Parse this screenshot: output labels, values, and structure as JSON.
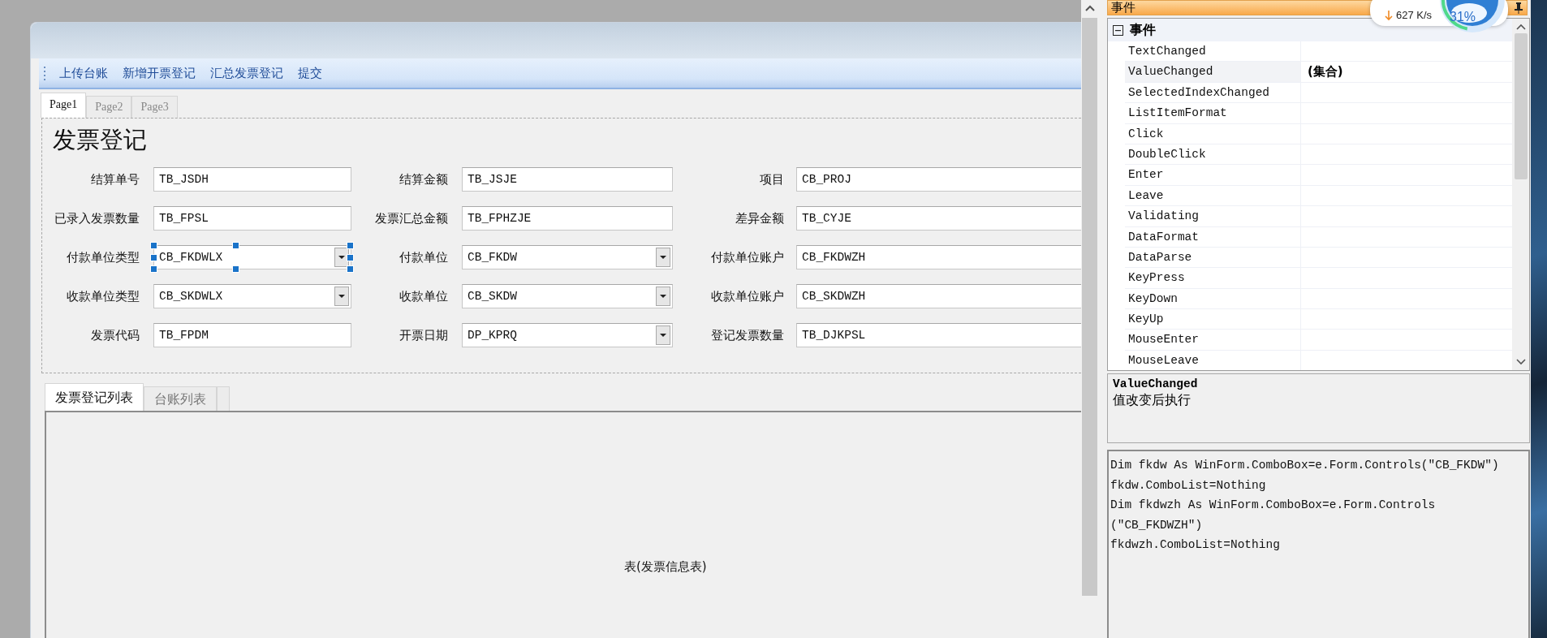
{
  "designer": {
    "toolbar": [
      {
        "label": "上传台账"
      },
      {
        "label": "新增开票登记"
      },
      {
        "label": "汇总发票登记"
      },
      {
        "label": "提交"
      }
    ],
    "page_tabs": [
      {
        "label": "Page1",
        "selected": true
      },
      {
        "label": "Page2",
        "selected": false
      },
      {
        "label": "Page3",
        "selected": false
      }
    ],
    "form": {
      "title": "发票登记",
      "rows": [
        [
          {
            "label": "结算单号",
            "value": "TB_JSDH",
            "kind": "text",
            "selected": false
          },
          {
            "label": "结算金额",
            "value": "TB_JSJE",
            "kind": "text",
            "selected": false
          },
          {
            "label": "项目",
            "value": "CB_PROJ",
            "kind": "text",
            "selected": false
          }
        ],
        [
          {
            "label": "已录入发票数量",
            "value": "TB_FPSL",
            "kind": "text",
            "selected": false
          },
          {
            "label": "发票汇总金额",
            "value": "TB_FPHZJE",
            "kind": "text",
            "selected": false
          },
          {
            "label": "差异金额",
            "value": "TB_CYJE",
            "kind": "text",
            "selected": false
          }
        ],
        [
          {
            "label": "付款单位类型",
            "value": "CB_FKDWLX",
            "kind": "combo",
            "selected": true
          },
          {
            "label": "付款单位",
            "value": "CB_FKDW",
            "kind": "combo",
            "selected": false
          },
          {
            "label": "付款单位账户",
            "value": "CB_FKDWZH",
            "kind": "text",
            "selected": false
          }
        ],
        [
          {
            "label": "收款单位类型",
            "value": "CB_SKDWLX",
            "kind": "combo",
            "selected": false
          },
          {
            "label": "收款单位",
            "value": "CB_SKDW",
            "kind": "combo",
            "selected": false
          },
          {
            "label": "收款单位账户",
            "value": "CB_SKDWZH",
            "kind": "text",
            "selected": false
          }
        ],
        [
          {
            "label": "发票代码",
            "value": "TB_FPDM",
            "kind": "text",
            "selected": false
          },
          {
            "label": "开票日期",
            "value": "DP_KPRQ",
            "kind": "combo",
            "selected": false
          },
          {
            "label": "登记发票数量",
            "value": "TB_DJKPSL",
            "kind": "text",
            "selected": false
          }
        ]
      ]
    },
    "list_tabs": [
      {
        "label": "发票登记列表",
        "selected": true
      },
      {
        "label": "台账列表",
        "selected": false
      }
    ],
    "table_placeholder": "表(发票信息表)"
  },
  "properties": {
    "title": "事件",
    "category": {
      "label": "事件",
      "expanded": true
    },
    "events": [
      {
        "name": "TextChanged",
        "selected": false
      },
      {
        "name": "ValueChanged",
        "value": "(集合)",
        "selected": true
      },
      {
        "name": "SelectedIndexChanged",
        "selected": false
      },
      {
        "name": "ListItemFormat",
        "selected": false
      },
      {
        "name": "Click",
        "selected": false
      },
      {
        "name": "DoubleClick",
        "selected": false
      },
      {
        "name": "Enter",
        "selected": false
      },
      {
        "name": "Leave",
        "selected": false
      },
      {
        "name": "Validating",
        "selected": false
      },
      {
        "name": "DataFormat",
        "selected": false
      },
      {
        "name": "DataParse",
        "selected": false
      },
      {
        "name": "KeyPress",
        "selected": false
      },
      {
        "name": "KeyDown",
        "selected": false
      },
      {
        "name": "KeyUp",
        "selected": false
      },
      {
        "name": "MouseEnter",
        "selected": false
      },
      {
        "name": "MouseLeave",
        "selected": false
      }
    ],
    "description": {
      "title": "ValueChanged",
      "text": "值改变后执行"
    },
    "code": [
      "Dim fkdw As WinForm.ComboBox=e.Form.Controls(\"CB_FKDW\")",
      "fkdw.ComboList=Nothing",
      "Dim fkdwzh As WinForm.ComboBox=e.Form.Controls",
      "(\"CB_FKDWZH\")",
      "fkdwzh.ComboList=Nothing"
    ]
  },
  "overlay": {
    "speed": "627 K/s",
    "percent": "31%"
  }
}
